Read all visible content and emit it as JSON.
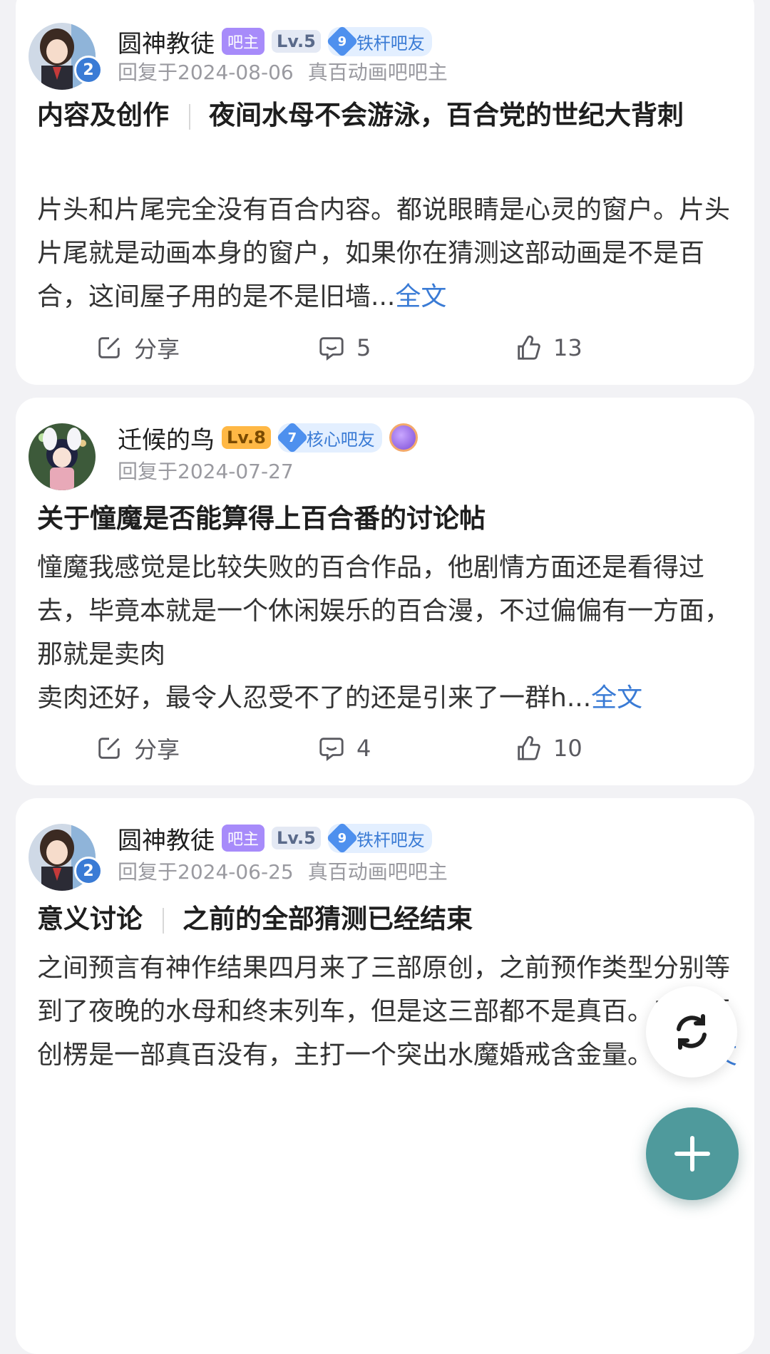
{
  "posts": [
    {
      "username": "圆神教徒",
      "owner_badge": "吧主",
      "level": "Lv.5",
      "fan_level": "9",
      "fan_title": "铁杆吧友",
      "reply_date": "回复于2024-08-06",
      "role": "真百动画吧吧主",
      "avatar_level": "2",
      "category": "内容及创作",
      "title": "夜间水母不会游泳，百合党的世纪大背刺",
      "body": "片头和片尾完全没有百合内容。都说眼睛是心灵的窗户。片头片尾就是动画本身的窗户，如果你在猜测这部动画是不是百合，这间屋子用的是不是旧墙...",
      "more": "全文",
      "share_label": "分享",
      "comments": "5",
      "likes": "13"
    },
    {
      "username": "迁候的鸟",
      "level": "Lv.8",
      "fan_level": "7",
      "fan_title": "核心吧友",
      "reply_date": "回复于2024-07-27",
      "title": "关于憧魔是否能算得上百合番的讨论帖",
      "body_lines": [
        "憧魔我感觉是比较失败的百合作品，他剧情方面还是看得过去，毕竟本就是一个休闲娱乐的百合漫，不过偏偏有一方面，那就是卖肉",
        "卖肉还好，最令人忍受不了的还是引来了一群h..."
      ],
      "more": "全文",
      "share_label": "分享",
      "comments": "4",
      "likes": "10"
    },
    {
      "username": "圆神教徒",
      "owner_badge": "吧主",
      "level": "Lv.5",
      "fan_level": "9",
      "fan_title": "铁杆吧友",
      "reply_date": "回复于2024-06-25",
      "role": "真百动画吧吧主",
      "avatar_level": "2",
      "category": "意义讨论",
      "title": "之前的全部猜测已经结束",
      "body": "之间预言有神作结果四月来了三部原创，之前预作类型分别等到了夜晚的水母和终末列车，但是这三部都不是真百。三部原创楞是一部真百没有，主打一个突出水魔婚戒含金量。 ...",
      "more": "全文"
    }
  ],
  "colors": {
    "accent": "#3a7bd5",
    "fab": "#4f9a9c",
    "owner_badge": "#a78bfa",
    "background": "#f2f2f5"
  },
  "icons": {
    "share": "share-icon",
    "comment": "comment-icon",
    "like": "like-icon",
    "refresh": "refresh-icon",
    "add": "add-icon"
  }
}
